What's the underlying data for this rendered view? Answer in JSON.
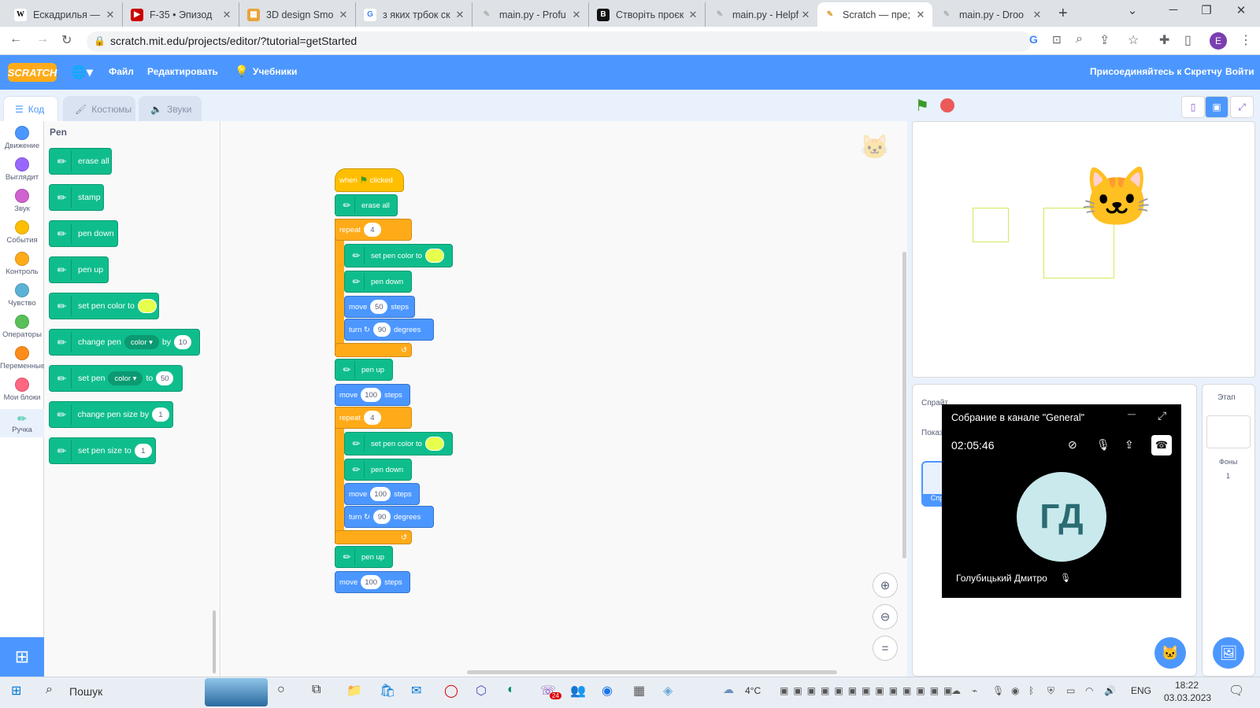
{
  "browser": {
    "tabs": [
      {
        "title": "Ескадрилья —",
        "icon": "W"
      },
      {
        "title": "F-35 • Эпизод",
        "icon": "▶"
      },
      {
        "title": "3D design Smo",
        "icon": "▦"
      },
      {
        "title": "з яких трбок ск",
        "icon": "G"
      },
      {
        "title": "main.py - Profu",
        "icon": "✎"
      },
      {
        "title": "Створіть проєк",
        "icon": "B"
      },
      {
        "title": "main.py - Helpf",
        "icon": "✎"
      },
      {
        "title": "Scratch — пре;",
        "icon": "✎"
      },
      {
        "title": "main.py - Droo",
        "icon": "✎"
      }
    ],
    "url": "scratch.mit.edu/projects/editor/?tutorial=getStarted",
    "profile_letter": "E"
  },
  "menubar": {
    "logo": "SCRATCH",
    "file": "Файл",
    "edit": "Редактировать",
    "tutorials": "Учебники",
    "join": "Присоединяйтесь к Скретчу",
    "signin": "Войти"
  },
  "editor_tabs": {
    "code": "Код",
    "costumes": "Костюмы",
    "sounds": "Звуки"
  },
  "categories": [
    {
      "label": "Движение",
      "color": "#4c97ff"
    },
    {
      "label": "Выглядит",
      "color": "#9966ff"
    },
    {
      "label": "Звук",
      "color": "#cf63cf"
    },
    {
      "label": "События",
      "color": "#ffbf00"
    },
    {
      "label": "Контроль",
      "color": "#ffab19"
    },
    {
      "label": "Чувство",
      "color": "#5cb1d6"
    },
    {
      "label": "Операторы",
      "color": "#59c059"
    },
    {
      "label": "Переменные",
      "color": "#ff8c1a"
    },
    {
      "label": "Мои блоки",
      "color": "#ff6680"
    },
    {
      "label": "Ручка",
      "color": "#0fbd8c"
    }
  ],
  "palette": {
    "heading": "Pen",
    "erase_all": "erase all",
    "stamp": "stamp",
    "pen_down": "pen down",
    "pen_up": "pen up",
    "set_pen_color_to": "set pen color to",
    "change_pen": "change pen",
    "color_option": "color",
    "by": "by",
    "change_by_value": "10",
    "set_pen": "set pen",
    "to": "to",
    "set_to_value": "50",
    "change_pen_size_by": "change pen size by",
    "change_size_value": "1",
    "set_pen_size_to": "set pen size to",
    "set_size_value": "1"
  },
  "script": {
    "when": "when",
    "clicked": "clicked",
    "erase_all": "erase all",
    "repeat": "repeat",
    "repeat_count_1": "4",
    "set_pen_color_to": "set pen color to",
    "pen_down": "pen down",
    "move": "move",
    "steps": "steps",
    "move_1": "50",
    "turn": "turn",
    "degrees": "degrees",
    "turn_1": "90",
    "pen_up": "pen up",
    "move_2": "100",
    "repeat_count_2": "4",
    "move_3": "100",
    "turn_2": "90",
    "move_4": "100"
  },
  "sprite_pane": {
    "sprite_label": "Спрайт",
    "show_label": "Показ",
    "sprite_name": "Спр",
    "stage_label": "Этап",
    "backdrops_label": "Фоны",
    "backdrops_count": "1"
  },
  "teams": {
    "title": "Собрание в канале \"General\"",
    "timer": "02:05:46",
    "initials": "ГД",
    "participant": "Голубицький Дмитро"
  },
  "taskbar": {
    "search": "Пошук",
    "temperature": "4°C",
    "language": "ENG",
    "time": "18:22",
    "date": "03.03.2023",
    "teams_badge": "24"
  },
  "colors": {
    "scratch_blue": "#4c97ff",
    "pen_green": "#0fbd8c",
    "control_orange": "#ffab19",
    "events_yellow": "#ffbf00",
    "pen_color_swatch": "#e6ff4d"
  }
}
